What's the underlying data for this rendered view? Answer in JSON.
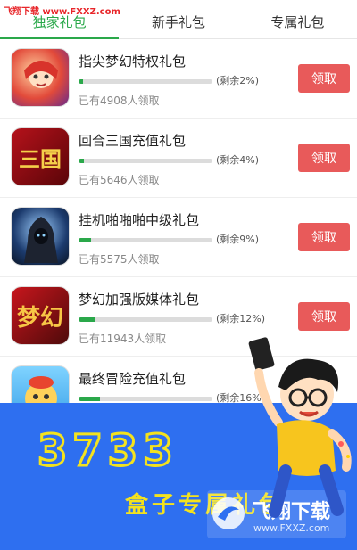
{
  "watermark_top": "飞翔下载 www.FXXZ.com",
  "tabs": [
    {
      "label": "独家礼包",
      "active": true
    },
    {
      "label": "新手礼包",
      "active": false
    },
    {
      "label": "专属礼包",
      "active": false
    }
  ],
  "items": [
    {
      "title": "指尖梦幻特权礼包",
      "remain": "(剩余2%)",
      "remain_fraction": 0.02,
      "count": "已有4908人领取",
      "button": "领取",
      "icon": "fantasy-girl-game-icon",
      "icon_text": ""
    },
    {
      "title": "回合三国充值礼包",
      "remain": "(剩余4%)",
      "remain_fraction": 0.04,
      "count": "已有5646人领取",
      "button": "领取",
      "icon": "three-kingdoms-game-icon",
      "icon_text": "三国"
    },
    {
      "title": "挂机啪啪啪中级礼包",
      "remain": "(剩余9%)",
      "remain_fraction": 0.09,
      "count": "已有5575人领取",
      "button": "领取",
      "icon": "hooded-warrior-game-icon",
      "icon_text": ""
    },
    {
      "title": "梦幻加强版媒体礼包",
      "remain": "(剩余12%)",
      "remain_fraction": 0.12,
      "count": "已有11943人领取",
      "button": "领取",
      "icon": "dream-fantasy-game-icon",
      "icon_text": "梦幻"
    },
    {
      "title": "最终冒险充值礼包",
      "remain": "(剩余16%",
      "remain_fraction": 0.16,
      "count": "",
      "button": "",
      "icon": "adventure-cartoon-game-icon",
      "icon_text": ""
    }
  ],
  "banner": {
    "big_text": "3733",
    "slogan": "盒子专属礼包",
    "watermark_main": "飞翔下载",
    "watermark_sub": "www.FXXZ.com"
  },
  "colors": {
    "accent": "#2aa84a",
    "button": "#e85a5a",
    "banner": "#2e6ff0",
    "banner_text": "#f3e21e"
  }
}
